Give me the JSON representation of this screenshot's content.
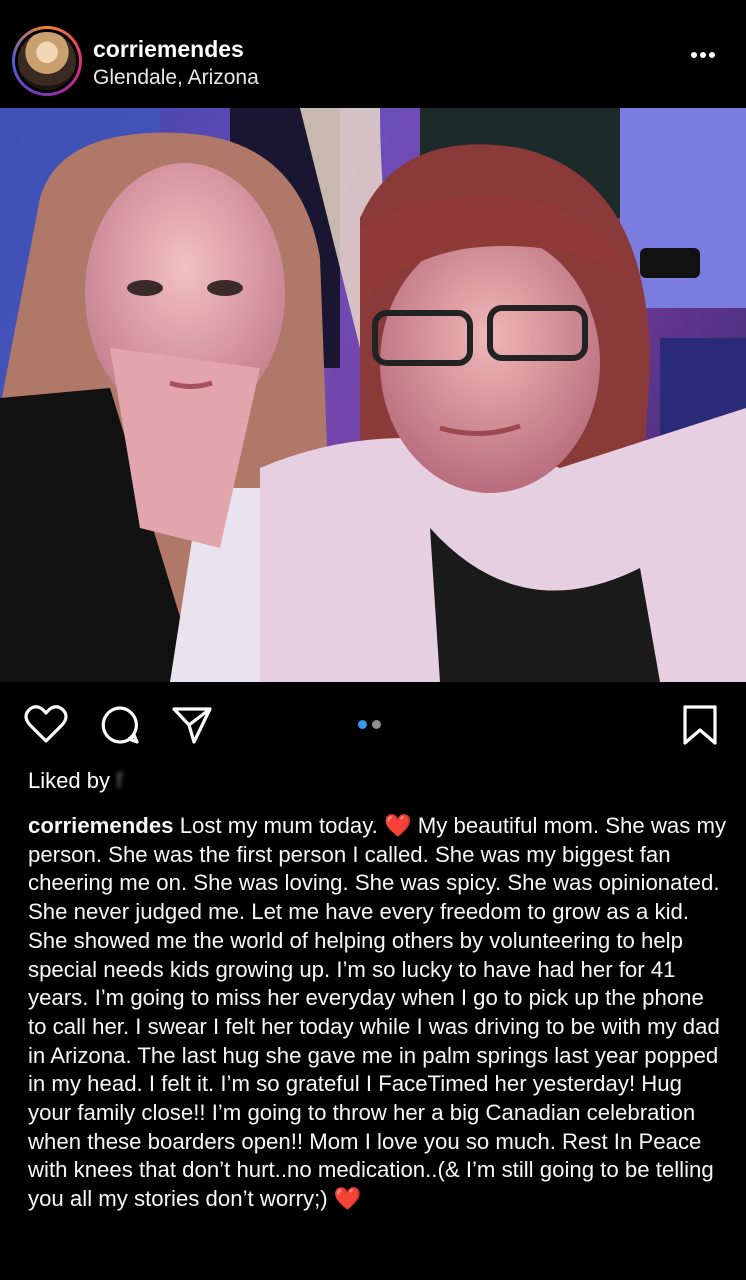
{
  "post": {
    "username": "corriemendes",
    "location": "Glendale, Arizona",
    "more_icon": "more-horizontal-icon",
    "liked_prefix": "Liked by",
    "liked_rest_obscured": " f",
    "carousel": {
      "count": 2,
      "active_index": 0,
      "active_color": "#3897f0",
      "inactive_color": "#8e8e8e"
    },
    "caption_username": "corriemendes",
    "caption_part1": " Lost my mum today. ",
    "caption_emoji1": "❤️",
    "caption_part2": " My beautiful mom. She was my person. She was the first person I called. She was my biggest fan cheering me on. She was loving. She was spicy. She was opinionated. She never judged me. Let me have every freedom to grow as a kid. She showed me the world of helping others by volunteering to help special needs kids growing up. I’m so lucky to have had her for 41 years. I’m going to miss her everyday when I go to pick up the phone to call her. I swear I felt her today while I was driving to be with my dad in Arizona. The last hug she gave me in palm springs last year popped in my head. I felt it. I’m so grateful I FaceTimed her yesterday! Hug your family close!! I’m going to throw her a big Canadian celebration when these boarders open!! Mom I love you so much. Rest In Peace with knees that don’t hurt..no medication..(& I’m still going to be telling you all my stories don’t worry;) ",
    "caption_emoji2": "❤️"
  },
  "icons": {
    "like": "heart-icon",
    "comment": "comment-icon",
    "share": "send-icon",
    "save": "bookmark-icon"
  },
  "colors": {
    "background": "#000000",
    "heart_emoji": "#f15a22"
  }
}
